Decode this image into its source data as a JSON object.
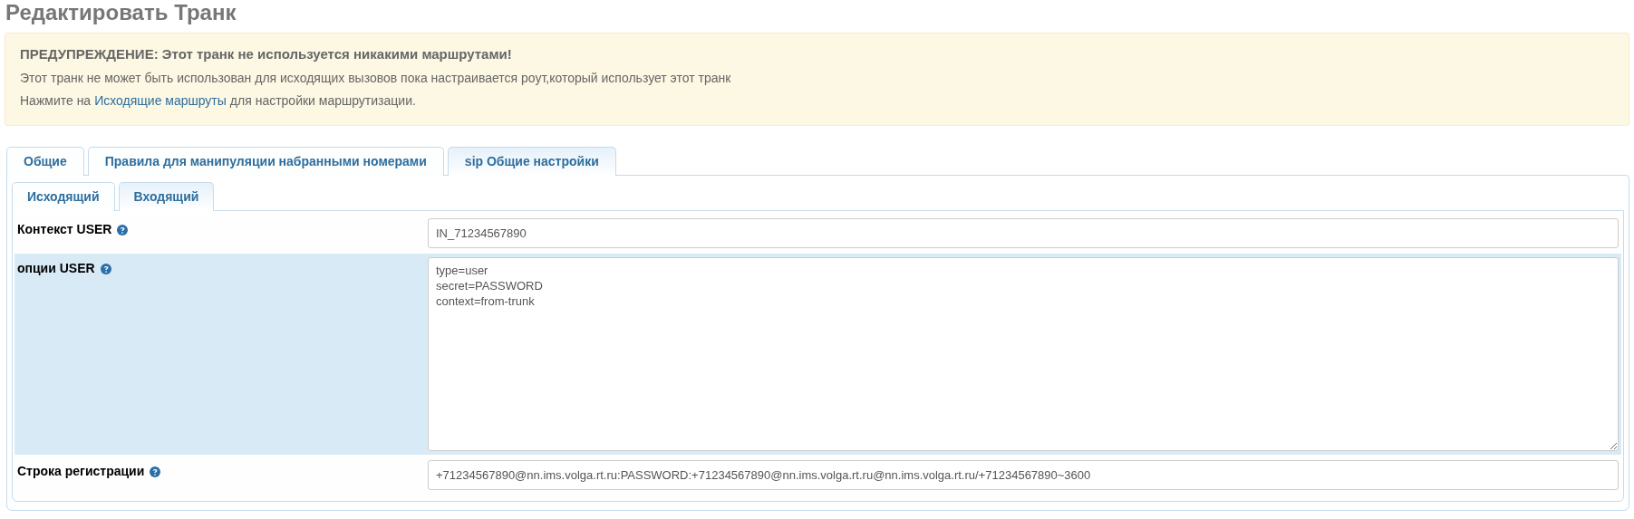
{
  "page_title": "Редактировать Транк",
  "warning": {
    "title": "ПРЕДУПРЕЖДЕНИЕ: Этот транк не используется никакими маршрутами!",
    "text": "Этот транк не может быть использован для исходящих вызовов пока настраивается роут,который использует этот транк",
    "hint_before": "Нажмите на",
    "hint_link": "Исходящие маршруты",
    "hint_after": "для настройки маршрутизации."
  },
  "tabs": [
    {
      "label": "Общие",
      "selected": false
    },
    {
      "label": "Правила для манипуляции набранными номерами",
      "selected": false
    },
    {
      "label": "sip Общие настройки",
      "selected": true
    }
  ],
  "subtabs": [
    {
      "label": "Исходящий",
      "selected": false
    },
    {
      "label": "Входящий",
      "selected": true
    }
  ],
  "fields": [
    {
      "label": "Контекст USER",
      "kind": "input",
      "value": "IN_71234567890",
      "highlighted": false
    },
    {
      "label": "опции USER",
      "kind": "textarea",
      "value": "type=user\nsecret=PASSWORD\ncontext=from-trunk",
      "highlighted": true
    },
    {
      "label": "Строка регистрации",
      "kind": "input",
      "value": "+71234567890@nn.ims.volga.rt.ru:PASSWORD:+71234567890@nn.ims.volga.rt.ru@nn.ims.volga.rt.ru/+71234567890~3600",
      "highlighted": false
    }
  ]
}
